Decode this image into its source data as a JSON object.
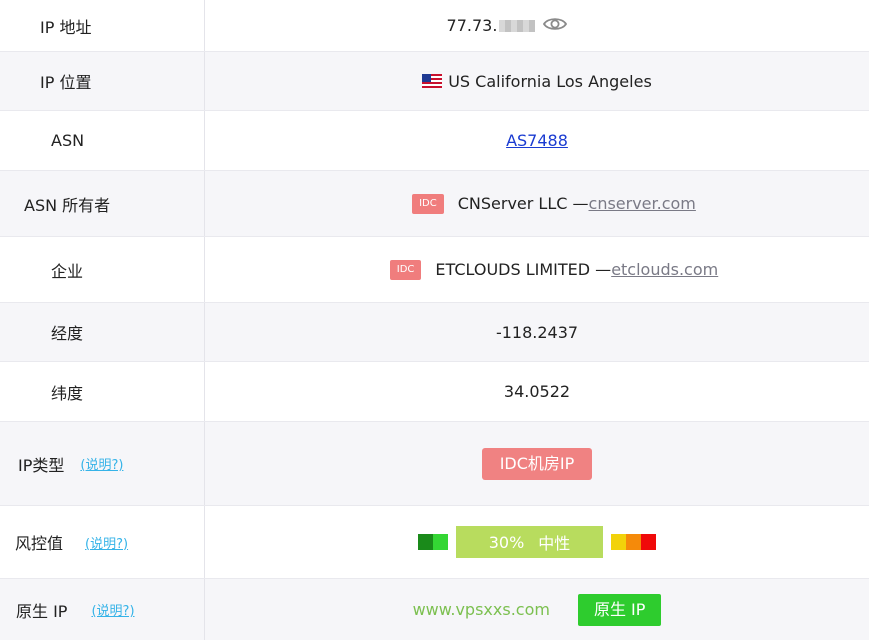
{
  "rows": {
    "ip_address": {
      "label": "IP 地址",
      "value": "77.73."
    },
    "ip_location": {
      "label": "IP 位置",
      "value": "US California Los Angeles",
      "flag": "us-flag-icon"
    },
    "asn": {
      "label": "ASN",
      "value": "AS7488"
    },
    "asn_owner": {
      "label": "ASN 所有者",
      "tag": "IDC",
      "name": "CNServer LLC —",
      "domain": "cnserver.com"
    },
    "company": {
      "label": "企业",
      "tag": "IDC",
      "name": "ETCLOUDS LIMITED —",
      "domain": "etclouds.com"
    },
    "longitude": {
      "label": "经度",
      "value": "-118.2437"
    },
    "latitude": {
      "label": "纬度",
      "value": "34.0522"
    },
    "ip_type": {
      "label": "IP类型",
      "help": "(说明?)",
      "value": "IDC机房IP"
    },
    "risk": {
      "label": "风控值",
      "help": "(说明?)",
      "percent": "30%",
      "level": "中性"
    },
    "native_ip": {
      "label": "原生 IP",
      "help": "(说明?)",
      "watermark": "www.vpsxxs.com",
      "value": "原生 IP"
    }
  },
  "colors": {
    "idc_tag": "#f07d7d",
    "link_blue": "#1a3bd1",
    "help_link": "#35b3e8",
    "risk_bar": "#b8dc5e",
    "native_btn": "#2ecc2e"
  }
}
